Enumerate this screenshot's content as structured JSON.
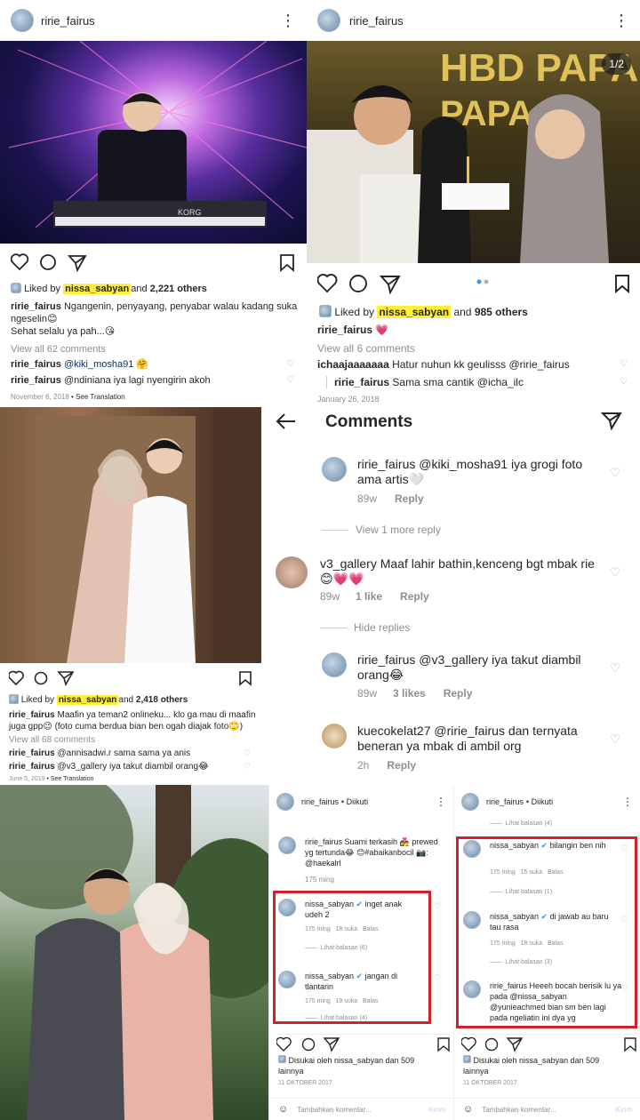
{
  "p1": {
    "user": "ririe_fairus",
    "liked_prefix": "Liked by",
    "liked_user": "nissa_sabyan",
    "liked_mid": "and",
    "liked_count": "2,221 others",
    "cap_user": "ririe_fairus",
    "cap_text": "Ngangenin, penyayang, penyabar walau kadang suka ngeselin😊",
    "cap_line2": "Sehat selalu ya pah...😘",
    "view_all": "View all 62 comments",
    "c1_user": "ririe_fairus",
    "c1_text": "@kiki_mosha91 🤗",
    "c2_user": "ririe_fairus",
    "c2_text": "@ndiniana iya lagi nyengirin akoh",
    "date": "November 6, 2018",
    "see": "See Translation"
  },
  "p2": {
    "user": "ririe_fairus",
    "counter": "1/2",
    "cake_text": "HBD PAPA",
    "liked_prefix": "Liked by",
    "liked_user": "nissa_sabyan",
    "liked_mid": "and",
    "liked_count": "985 others",
    "cap_user": "ririe_fairus",
    "cap_text": "💗",
    "view_all": "View all 6 comments",
    "c1_user": "ichaajaaaaaaa",
    "c1_text": "Hatur nuhun kk geulisss @ririe_fairus",
    "c2_user": "ririe_fairus",
    "c2_text": "Sama sma cantik @icha_ilc",
    "date": "January 26, 2018"
  },
  "p3": {
    "liked_prefix": "Liked by",
    "liked_user": "nissa_sabyan",
    "liked_mid": "and",
    "liked_count": "2,418 others",
    "cap_user": "ririe_fairus",
    "cap_text": "Maafin ya teman2 onlineku... klo ga mau di maafin juga gpp😉 (foto cuma berdua bian ben ogah diajak foto🙄)",
    "view_all": "View all 68 comments",
    "c1_user": "ririe_fairus",
    "c1_text": "@annisadwi.r sama sama ya anis",
    "c2_user": "ririe_fairus",
    "c2_text": "@v3_gallery iya takut diambil orang😂",
    "date": "June 5, 2019",
    "see": "See Translation"
  },
  "comments": {
    "title": "Comments",
    "items": [
      {
        "user": "ririe_fairus",
        "text": "@kiki_mosha91 iya grogi foto ama artis🤍",
        "time": "89w",
        "likes": "",
        "reply": "Reply"
      },
      {
        "user": "v3_gallery",
        "text": "Maaf lahir bathin,kenceng bgt mbak rie 😊💗💗",
        "time": "89w",
        "likes": "1 like",
        "reply": "Reply"
      },
      {
        "user": "ririe_fairus",
        "text": "@v3_gallery iya takut diambil orang😂",
        "time": "89w",
        "likes": "3 likes",
        "reply": "Reply"
      },
      {
        "user": "kuecokelat27",
        "text": "@ririe_fairus dan ternyata beneran ya mbak di ambil org",
        "time": "2h",
        "likes": "",
        "reply": "Reply"
      }
    ],
    "view_more": "View 1 more reply",
    "hide": "Hide replies"
  },
  "p5": {
    "user": "ririe_fairus",
    "follow": "• Diikuti",
    "cap_user": "ririe_fairus",
    "cap_text": "Suami terkasih 👩‍❤️‍👨 prewed yg tertunda😂 😊#abaikanbocil 📷: @haekalrl",
    "cap_time": "175 ming",
    "c1_user": "nissa_sabyan",
    "c1_text": "inget anak udeh 2",
    "c1_time": "175 ming",
    "c1_likes": "18 suka",
    "c1_reply": "Balas",
    "c1_more": "Lihat balasan (6)",
    "c2_user": "nissa_sabyan",
    "c2_text": "jangan di tlantarin",
    "c2_time": "175 ming",
    "c2_likes": "19 suka",
    "c2_reply": "Balas",
    "c2_more": "Lihat balasan (4)",
    "liked": "Disukai oleh nissa_sabyan dan 509 lainnya",
    "date": "11 OKTOBER 2017",
    "add": "Tambahkan komentar...",
    "post": "Kirim"
  },
  "p6": {
    "user": "ririe_fairus",
    "follow": "• Diikuti",
    "top_more": "Lihat balasan (4)",
    "c1_user": "nissa_sabyan",
    "c1_text": "bilangin ben nih",
    "c1_time": "175 ming",
    "c1_likes": "15 suka",
    "c1_reply": "Balas",
    "c1_more": "Lihat balasan (1)",
    "c2_user": "nissa_sabyan",
    "c2_text": "di jawab au baru tau rasa",
    "c2_time": "175 ming",
    "c2_likes": "18 suka",
    "c2_reply": "Balas",
    "c2_more": "Lihat balasan (3)",
    "c3_user": "ririe_fairus",
    "c3_text": "Heeeh bocah berisik lu ya pada @nissa_sabyan @yunieachmed bian sm ben lagi pada ngeliatin ini dya yg",
    "liked": "Disukai oleh nissa_sabyan dan 509 lainnya",
    "date": "11 OKTOBER 2017",
    "add": "Tambahkan komentar...",
    "post": "Kirim"
  },
  "colors": {
    "highlight": "#ffef3a",
    "red_box": "#d0222a",
    "link": "#003569"
  }
}
